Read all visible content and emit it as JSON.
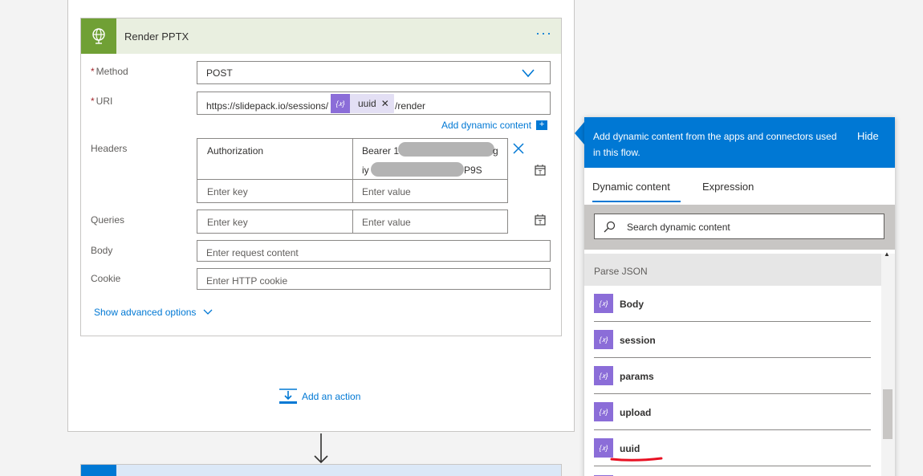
{
  "card": {
    "title": "Render PPTX",
    "more": "···"
  },
  "method": {
    "label": "Method",
    "required": "*",
    "value": "POST"
  },
  "uri": {
    "label": "URI",
    "required": "*",
    "prefix": "https://slidepack.io/sessions/",
    "token": "uuid",
    "suffix": "/render",
    "add_dynamic": "Add dynamic content"
  },
  "headers": {
    "label": "Headers",
    "key": "Authorization",
    "value_line1_start": "Bearer 1",
    "value_line1_end": "g",
    "value_line2_start": "iy",
    "value_line2_end": "P9S",
    "key_placeholder": "Enter key",
    "value_placeholder": "Enter value"
  },
  "queries": {
    "label": "Queries",
    "key_placeholder": "Enter key",
    "value_placeholder": "Enter value"
  },
  "body": {
    "label": "Body",
    "placeholder": "Enter request content"
  },
  "cookie": {
    "label": "Cookie",
    "placeholder": "Enter HTTP cookie"
  },
  "advanced": "Show advanced options",
  "add_action": "Add an action",
  "panel": {
    "message": "Add dynamic content from the apps and connectors used in this flow.",
    "hide": "Hide",
    "tabs": [
      "Dynamic content",
      "Expression"
    ],
    "search_placeholder": "Search dynamic content",
    "group": "Parse JSON",
    "items": [
      "Body",
      "session",
      "params",
      "upload",
      "uuid"
    ]
  },
  "colors": {
    "accent": "#0078d4",
    "action_green": "#70a035",
    "token_purple": "#8b6dd8",
    "highlight_red": "#e81123"
  }
}
